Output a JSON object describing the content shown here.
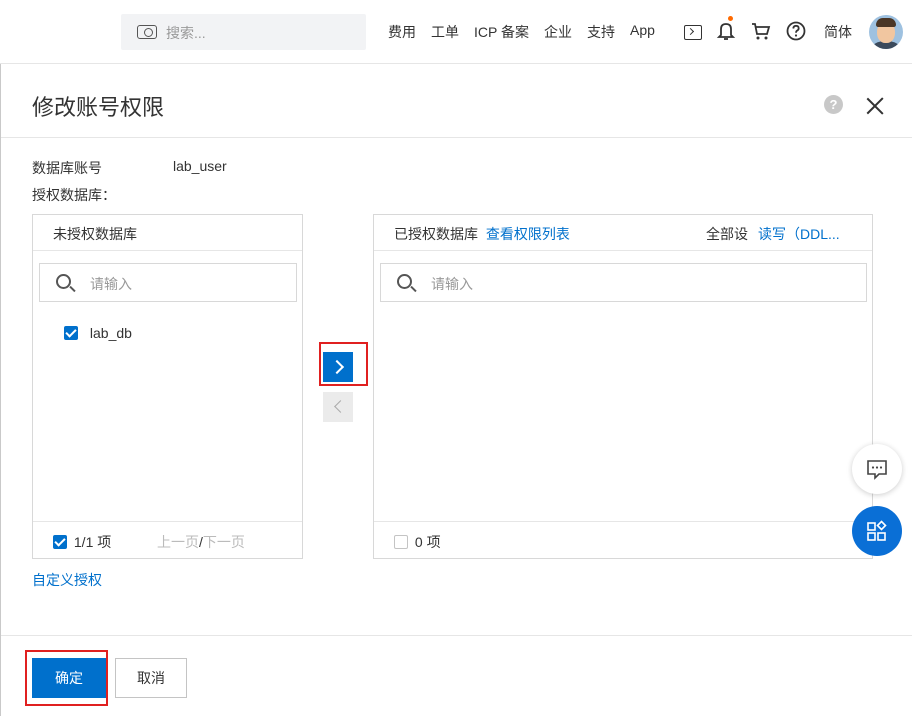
{
  "topbar": {
    "search_placeholder": "搜索...",
    "nav": [
      "费用",
      "工单",
      "ICP 备案",
      "企业",
      "支持",
      "App"
    ],
    "icons": [
      "terminal-icon",
      "bell-icon",
      "cart-icon",
      "help-icon"
    ],
    "lang": "简体",
    "notification_color": "#ff6a00"
  },
  "dialog": {
    "title": "修改账号权限",
    "account_label": "数据库账号",
    "account_value": "lab_user",
    "authorize_label": "授权数据库：",
    "left_panel": {
      "title": "未授权数据库",
      "search_placeholder": "请输入",
      "items": [
        {
          "label": "lab_db",
          "checked": true
        }
      ],
      "footer_count": "1/1 项",
      "prev_page": "上一页",
      "page_sep": "/",
      "next_page": "下一页"
    },
    "right_panel": {
      "title": "已授权数据库",
      "view_link": "查看权限列表",
      "set_all_label": "全部设",
      "set_all_value": "读写（DDL...",
      "search_placeholder": "请输入",
      "footer_count": "0 项"
    },
    "custom_link": "自定义授权",
    "ok_label": "确定",
    "cancel_label": "取消",
    "help_glyph": "?"
  },
  "colors": {
    "accent": "#0070cc",
    "highlight_box": "#e02020"
  }
}
